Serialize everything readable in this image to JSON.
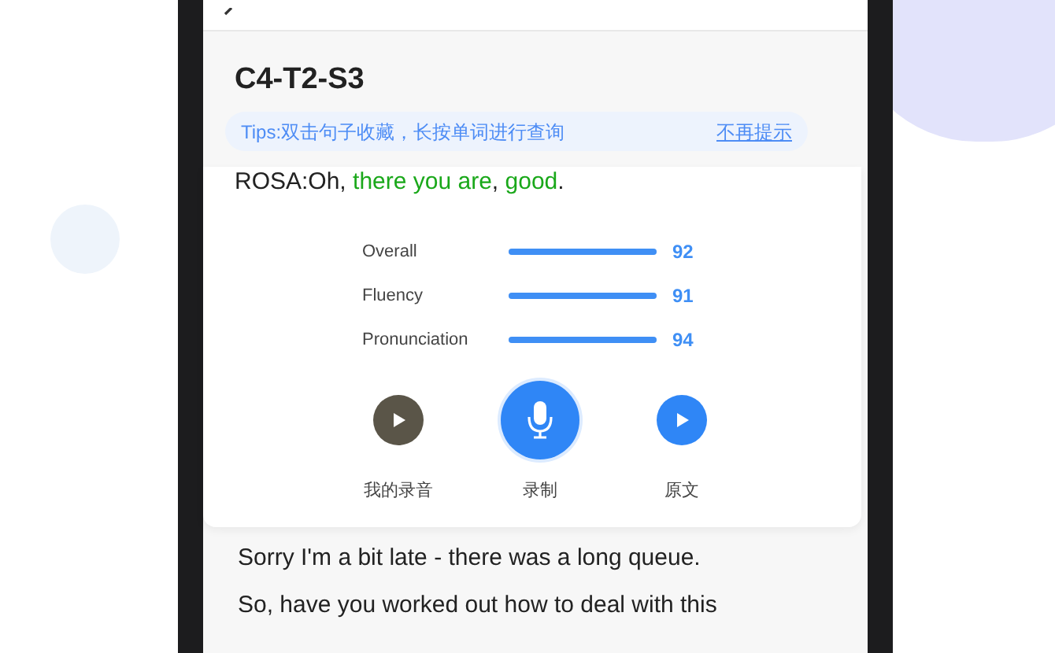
{
  "lesson": {
    "title": "C4-T2-S3"
  },
  "tips": {
    "text": "Tips:双击句子收藏，长按单词进行查询",
    "dismiss": "不再提示"
  },
  "current_sentence": [
    {
      "text": "ROSA:Oh, ",
      "highlighted": false
    },
    {
      "text": "there you are",
      "highlighted": true
    },
    {
      "text": ", ",
      "highlighted": false
    },
    {
      "text": "good",
      "highlighted": true
    },
    {
      "text": ".",
      "highlighted": false
    }
  ],
  "scores": [
    {
      "label": "Overall",
      "level": 1,
      "reading": "92"
    },
    {
      "label": "Fluency",
      "level": 1,
      "reading": "91"
    },
    {
      "label": "Pronunciation",
      "level": 1,
      "reading": "94"
    }
  ],
  "actions": [
    {
      "kind": "recording",
      "label": "我的录音"
    },
    {
      "kind": "record",
      "label": "录制"
    },
    {
      "kind": "original",
      "label": "原文"
    }
  ],
  "sentences": [
    "Sorry I'm a bit late - there was a long queue.",
    "So, have you worked out how to deal with this"
  ]
}
